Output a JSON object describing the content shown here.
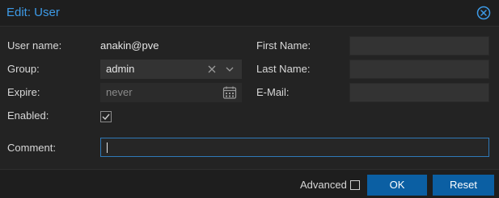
{
  "dialog": {
    "title": "Edit: User"
  },
  "form": {
    "username_label": "User name:",
    "username_value": "anakin@pve",
    "group_label": "Group:",
    "group_value": "admin",
    "expire_label": "Expire:",
    "expire_placeholder": "never",
    "enabled_label": "Enabled:",
    "enabled_checked": true,
    "firstname_label": "First Name:",
    "firstname_value": "",
    "lastname_label": "Last Name:",
    "lastname_value": "",
    "email_label": "E-Mail:",
    "email_value": "",
    "comment_label": "Comment:",
    "comment_value": ""
  },
  "footer": {
    "advanced_label": "Advanced",
    "advanced_checked": false,
    "ok_label": "OK",
    "reset_label": "Reset"
  },
  "colors": {
    "accent": "#3d9be8",
    "button": "#0b5fa3",
    "focus_border": "#2f79b8"
  },
  "icons": [
    "close-circle-icon",
    "clear-x-icon",
    "chevron-down-icon",
    "calendar-icon",
    "checkmark-icon"
  ]
}
